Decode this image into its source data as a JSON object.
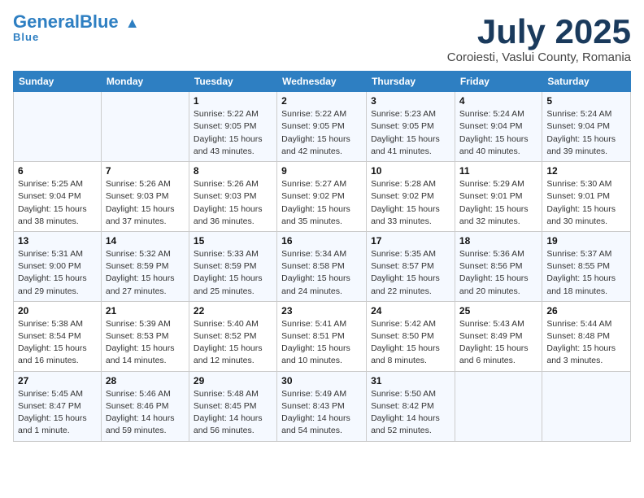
{
  "header": {
    "logo_general": "General",
    "logo_blue": "Blue",
    "title": "July 2025",
    "subtitle": "Coroiesti, Vaslui County, Romania"
  },
  "columns": [
    "Sunday",
    "Monday",
    "Tuesday",
    "Wednesday",
    "Thursday",
    "Friday",
    "Saturday"
  ],
  "weeks": [
    [
      {
        "day": "",
        "detail": ""
      },
      {
        "day": "",
        "detail": ""
      },
      {
        "day": "1",
        "detail": "Sunrise: 5:22 AM\nSunset: 9:05 PM\nDaylight: 15 hours\nand 43 minutes."
      },
      {
        "day": "2",
        "detail": "Sunrise: 5:22 AM\nSunset: 9:05 PM\nDaylight: 15 hours\nand 42 minutes."
      },
      {
        "day": "3",
        "detail": "Sunrise: 5:23 AM\nSunset: 9:05 PM\nDaylight: 15 hours\nand 41 minutes."
      },
      {
        "day": "4",
        "detail": "Sunrise: 5:24 AM\nSunset: 9:04 PM\nDaylight: 15 hours\nand 40 minutes."
      },
      {
        "day": "5",
        "detail": "Sunrise: 5:24 AM\nSunset: 9:04 PM\nDaylight: 15 hours\nand 39 minutes."
      }
    ],
    [
      {
        "day": "6",
        "detail": "Sunrise: 5:25 AM\nSunset: 9:04 PM\nDaylight: 15 hours\nand 38 minutes."
      },
      {
        "day": "7",
        "detail": "Sunrise: 5:26 AM\nSunset: 9:03 PM\nDaylight: 15 hours\nand 37 minutes."
      },
      {
        "day": "8",
        "detail": "Sunrise: 5:26 AM\nSunset: 9:03 PM\nDaylight: 15 hours\nand 36 minutes."
      },
      {
        "day": "9",
        "detail": "Sunrise: 5:27 AM\nSunset: 9:02 PM\nDaylight: 15 hours\nand 35 minutes."
      },
      {
        "day": "10",
        "detail": "Sunrise: 5:28 AM\nSunset: 9:02 PM\nDaylight: 15 hours\nand 33 minutes."
      },
      {
        "day": "11",
        "detail": "Sunrise: 5:29 AM\nSunset: 9:01 PM\nDaylight: 15 hours\nand 32 minutes."
      },
      {
        "day": "12",
        "detail": "Sunrise: 5:30 AM\nSunset: 9:01 PM\nDaylight: 15 hours\nand 30 minutes."
      }
    ],
    [
      {
        "day": "13",
        "detail": "Sunrise: 5:31 AM\nSunset: 9:00 PM\nDaylight: 15 hours\nand 29 minutes."
      },
      {
        "day": "14",
        "detail": "Sunrise: 5:32 AM\nSunset: 8:59 PM\nDaylight: 15 hours\nand 27 minutes."
      },
      {
        "day": "15",
        "detail": "Sunrise: 5:33 AM\nSunset: 8:59 PM\nDaylight: 15 hours\nand 25 minutes."
      },
      {
        "day": "16",
        "detail": "Sunrise: 5:34 AM\nSunset: 8:58 PM\nDaylight: 15 hours\nand 24 minutes."
      },
      {
        "day": "17",
        "detail": "Sunrise: 5:35 AM\nSunset: 8:57 PM\nDaylight: 15 hours\nand 22 minutes."
      },
      {
        "day": "18",
        "detail": "Sunrise: 5:36 AM\nSunset: 8:56 PM\nDaylight: 15 hours\nand 20 minutes."
      },
      {
        "day": "19",
        "detail": "Sunrise: 5:37 AM\nSunset: 8:55 PM\nDaylight: 15 hours\nand 18 minutes."
      }
    ],
    [
      {
        "day": "20",
        "detail": "Sunrise: 5:38 AM\nSunset: 8:54 PM\nDaylight: 15 hours\nand 16 minutes."
      },
      {
        "day": "21",
        "detail": "Sunrise: 5:39 AM\nSunset: 8:53 PM\nDaylight: 15 hours\nand 14 minutes."
      },
      {
        "day": "22",
        "detail": "Sunrise: 5:40 AM\nSunset: 8:52 PM\nDaylight: 15 hours\nand 12 minutes."
      },
      {
        "day": "23",
        "detail": "Sunrise: 5:41 AM\nSunset: 8:51 PM\nDaylight: 15 hours\nand 10 minutes."
      },
      {
        "day": "24",
        "detail": "Sunrise: 5:42 AM\nSunset: 8:50 PM\nDaylight: 15 hours\nand 8 minutes."
      },
      {
        "day": "25",
        "detail": "Sunrise: 5:43 AM\nSunset: 8:49 PM\nDaylight: 15 hours\nand 6 minutes."
      },
      {
        "day": "26",
        "detail": "Sunrise: 5:44 AM\nSunset: 8:48 PM\nDaylight: 15 hours\nand 3 minutes."
      }
    ],
    [
      {
        "day": "27",
        "detail": "Sunrise: 5:45 AM\nSunset: 8:47 PM\nDaylight: 15 hours\nand 1 minute."
      },
      {
        "day": "28",
        "detail": "Sunrise: 5:46 AM\nSunset: 8:46 PM\nDaylight: 14 hours\nand 59 minutes."
      },
      {
        "day": "29",
        "detail": "Sunrise: 5:48 AM\nSunset: 8:45 PM\nDaylight: 14 hours\nand 56 minutes."
      },
      {
        "day": "30",
        "detail": "Sunrise: 5:49 AM\nSunset: 8:43 PM\nDaylight: 14 hours\nand 54 minutes."
      },
      {
        "day": "31",
        "detail": "Sunrise: 5:50 AM\nSunset: 8:42 PM\nDaylight: 14 hours\nand 52 minutes."
      },
      {
        "day": "",
        "detail": ""
      },
      {
        "day": "",
        "detail": ""
      }
    ]
  ]
}
